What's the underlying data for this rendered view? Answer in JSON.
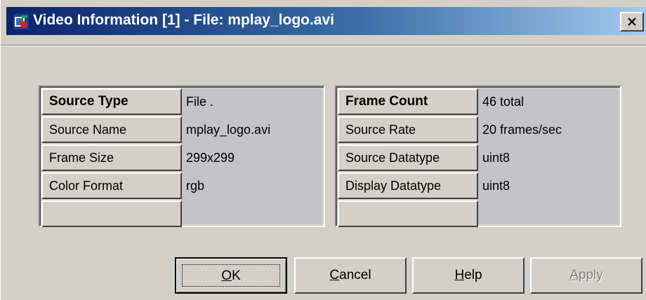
{
  "window": {
    "title": "Video Information [1] - File: mplay_logo.avi",
    "close_label": "×"
  },
  "left_panel": {
    "rows": [
      {
        "label": "Source Type",
        "value": "File ."
      },
      {
        "label": "Source Name",
        "value": "mplay_logo.avi"
      },
      {
        "label": "Frame Size",
        "value": "299x299"
      },
      {
        "label": "Color Format",
        "value": "rgb"
      }
    ]
  },
  "right_panel": {
    "rows": [
      {
        "label": "Frame Count",
        "value": "46 total"
      },
      {
        "label": "Source Rate",
        "value": "20 frames/sec"
      },
      {
        "label": "Source Datatype",
        "value": "uint8"
      },
      {
        "label": "Display Datatype",
        "value": "uint8"
      }
    ]
  },
  "buttons": {
    "ok": {
      "mnemonic": "O",
      "rest": "K"
    },
    "cancel": {
      "mnemonic": "C",
      "rest": "ancel"
    },
    "help": {
      "mnemonic": "H",
      "rest": "elp"
    },
    "apply": {
      "mnemonic": "A",
      "rest": "pply",
      "enabled": false
    }
  },
  "icons": {
    "app_icon": "matlab-video-icon",
    "close_icon": "close-icon"
  },
  "colors": {
    "title_gradient_start": "#0a246a",
    "title_gradient_end": "#a6caf0",
    "dialog_face": "#d4d0c8"
  }
}
